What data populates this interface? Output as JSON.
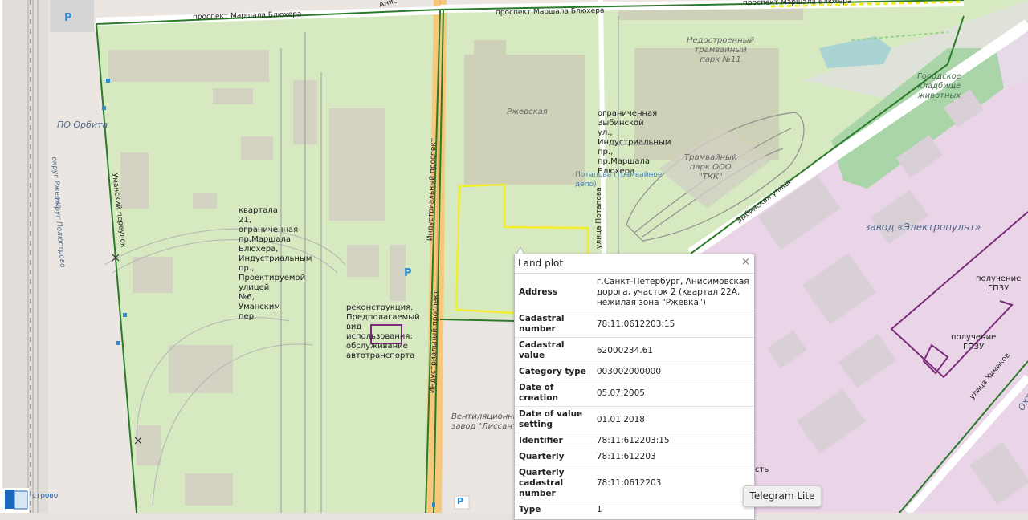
{
  "map": {
    "streets": {
      "marshala_blyukhera_1": "проспект Маршала Блюхера",
      "marshala_blyukhera_2": "проспект Маршала Блюхера",
      "marshala_blyukhera_3": "проспект Маршала Блюхера",
      "industrialny_1": "Индустриальный проспект",
      "industrialny_2": "Индустриальный проспект",
      "umansky": "Уманский переулок",
      "zybinskaya": "Зыбинская улица",
      "potapova": "улица Потапова",
      "khimikov": "улица Химиков",
      "okrug_rzhevka": "округ Ржевка",
      "okrug_polyustrovo": "округ Полюстрово",
      "anis": "Анис"
    },
    "places": {
      "po_orbita": "ПО Орбита",
      "rzhevskaya": "Ржевская",
      "depot_unfinished": "Недостроенный\nтрамвайный\nпарк №11",
      "tram_park": "Трамвайный\nпарк ООО\n\"ТКК\"",
      "potapova_depot": "Потапова (трамвайное\nдепо)",
      "cemetery": "Городское\nкладбище\nживотных",
      "elektropult": "завод «Электропульт»",
      "ventilation": "Вентиляционны\nзавод \"Лиссант",
      "okh": "Охт"
    },
    "lot_labels": {
      "quarter21": "квартала\n21,\nограниченная\nпр.Маршала\nБлюхера,\nИндустриальным\nпр.,\nПроектируемой\nулицей\n№6,\nУманским\nпер.",
      "reconstruction": "реконструкция.\nПредполагаемый\nвид\nиспользования:\nобслуживание\nавтотранспорта",
      "zybinskaya_lot": "ограниченная\nЗыбинской\nул.,\nИндустриальным\nпр.,\nпр.Маршала\nБлюхера",
      "gpzu1": "получение\nГПЗУ",
      "gpzu2": "получение\nГПЗУ",
      "cut_text": "сть"
    },
    "parking": "P",
    "stroy_label": "строво",
    "colors": {
      "green_zone": "#d8ebc4",
      "boundary": "#2a7a2a",
      "selected_plot": "#f2ec2a",
      "industrial": "#ecd4ea",
      "road_yellow": "#f7c87a"
    }
  },
  "popup": {
    "title": "Land plot",
    "close": "×",
    "rows": [
      {
        "key": "Address",
        "value": "г.Санкт-Петербург, Анисимовская дорога, участок 2 (квартал 22А, нежилая зона \"Ржевка\")"
      },
      {
        "key": "Cadastral number",
        "value": "78:11:0612203:15"
      },
      {
        "key": "Cadastral value",
        "value": "62000234.61"
      },
      {
        "key": "Category type",
        "value": "003002000000"
      },
      {
        "key": "Date of creation",
        "value": "05.07.2005"
      },
      {
        "key": "Date of value setting",
        "value": "01.01.2018"
      },
      {
        "key": "Identifier",
        "value": "78:11:612203:15"
      },
      {
        "key": "Quarterly",
        "value": "78:11:612203"
      },
      {
        "key": "Quarterly cadastral number",
        "value": "78:11:0612203"
      },
      {
        "key": "Type",
        "value": "1"
      }
    ]
  },
  "telegram": {
    "label": "Telegram Lite"
  }
}
